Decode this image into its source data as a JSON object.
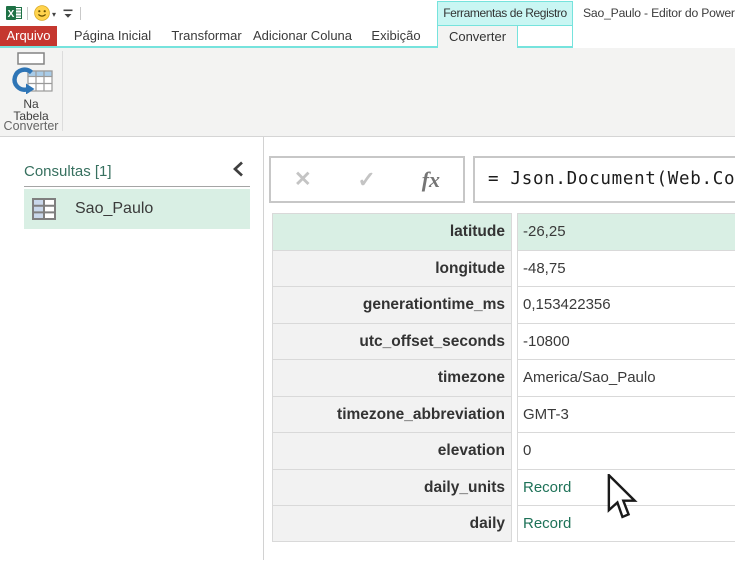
{
  "colors": {
    "accent_teal": "#76E3DD",
    "contextual_tab_bg": "#C9F6F3",
    "file_tab_red": "#C5372F",
    "selection_green": "#D9EFE4",
    "record_link_green": "#1E7258",
    "queries_header_green": "#37705F"
  },
  "titlebar": {
    "contextual_group": "Ferramentas de Registro",
    "window_title": "Sao_Paulo - Editor do Power",
    "qat_icons": [
      "excel-logo-icon",
      "smiley-icon",
      "customize-quick-access-icon"
    ]
  },
  "tabs": {
    "file": "Arquivo",
    "items": [
      "Página Inicial",
      "Transformar",
      "Adicionar Coluna",
      "Exibição"
    ],
    "contextual": "Converter"
  },
  "ribbon": {
    "button": {
      "line1": "Na",
      "line2": "Tabela",
      "icon": "convert-to-table-icon"
    },
    "group_label": "Converter"
  },
  "queries_pane": {
    "header": "Consultas [1]",
    "items": [
      {
        "name": "Sao_Paulo",
        "selected": true,
        "icon": "table-icon"
      }
    ]
  },
  "formula_bar": {
    "cancel_glyph": "✕",
    "accept_glyph": "✓",
    "fx_glyph": "fx",
    "formula": "= Json.Document(Web.Co"
  },
  "record": {
    "rows": [
      {
        "key": "latitude",
        "value": "-26,25",
        "selected": true
      },
      {
        "key": "longitude",
        "value": "-48,75"
      },
      {
        "key": "generationtime_ms",
        "value": "0,153422356"
      },
      {
        "key": "utc_offset_seconds",
        "value": "-10800"
      },
      {
        "key": "timezone",
        "value": "America/Sao_Paulo"
      },
      {
        "key": "timezone_abbreviation",
        "value": "GMT-3"
      },
      {
        "key": "elevation",
        "value": "0"
      },
      {
        "key": "daily_units",
        "value": "Record",
        "link": true
      },
      {
        "key": "daily",
        "value": "Record",
        "link": true
      }
    ]
  }
}
